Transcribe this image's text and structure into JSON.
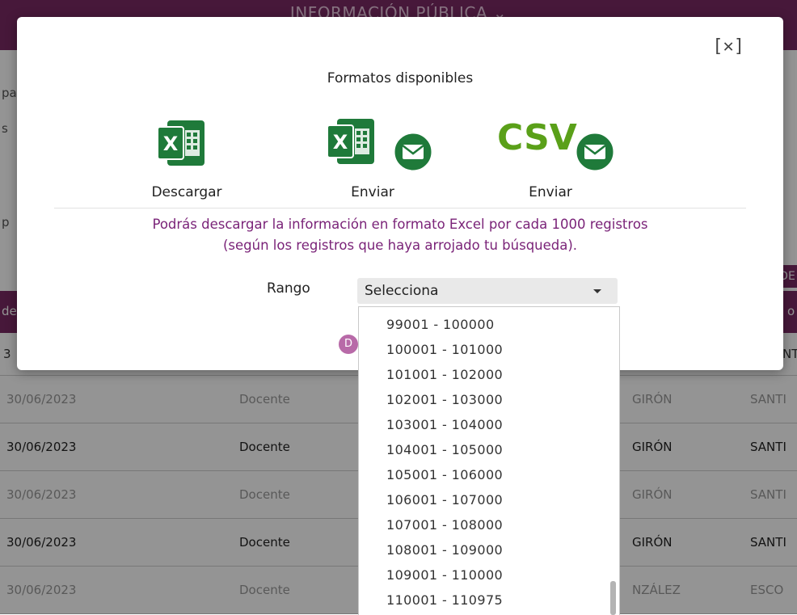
{
  "background": {
    "header_title": "INFORMACIÓN PÚBLICA ⌄",
    "fragments": {
      "pa": "pa",
      "s": "s",
      "p": "p",
      "de_head": "de",
      "o_head": "o",
      "de_btn": "DE",
      "row0_num": "3",
      "row0_right": "NT"
    },
    "rows": [
      {
        "date": "30/06/2023",
        "role": "Docente",
        "name": "GIRÓN",
        "last": "SANTI"
      },
      {
        "date": "30/06/2023",
        "role": "Docente",
        "name": "GIRÓN",
        "last": "SANTI"
      },
      {
        "date": "30/06/2023",
        "role": "Docente",
        "name": "GIRÓN",
        "last": "SANTI"
      },
      {
        "date": "30/06/2023",
        "role": "Docente",
        "name": "GIRÓN",
        "last": "SANTI"
      },
      {
        "date": "30/06/2023",
        "role": "Docente",
        "name": "NZÁLEZ",
        "last": "ESCO"
      }
    ]
  },
  "modal": {
    "close_label": "[✕]",
    "title": "Formatos disponibles",
    "formats": [
      {
        "icon": "excel-download-icon",
        "label": "Descargar"
      },
      {
        "icon": "excel-email-icon",
        "label": "Enviar"
      },
      {
        "icon": "csv-email-icon",
        "label": "Enviar"
      }
    ],
    "notice_line1": "Podrás descargar la información en formato Excel por cada 1000 registros",
    "notice_line2": "(según los registros que haya arrojado tu búsqueda).",
    "range_label": "Rango",
    "select_value": "Selecciona",
    "pill_text": "D",
    "csv_text": "CSV",
    "excel_glyph": "X"
  },
  "dropdown": {
    "options": [
      "99001 - 100000",
      "100001 - 101000",
      "101001 - 102000",
      "102001 - 103000",
      "103001 - 104000",
      "104001 - 105000",
      "105001 - 106000",
      "106001 - 107000",
      "107001 - 108000",
      "108001 - 109000",
      "109001 - 110000",
      "110001 - 110975"
    ]
  },
  "colors": {
    "brand_purple": "#7a2a64",
    "notice_purple": "#7a2378",
    "excel_green": "#1f7a3a",
    "csv_green": "#5aa019"
  }
}
